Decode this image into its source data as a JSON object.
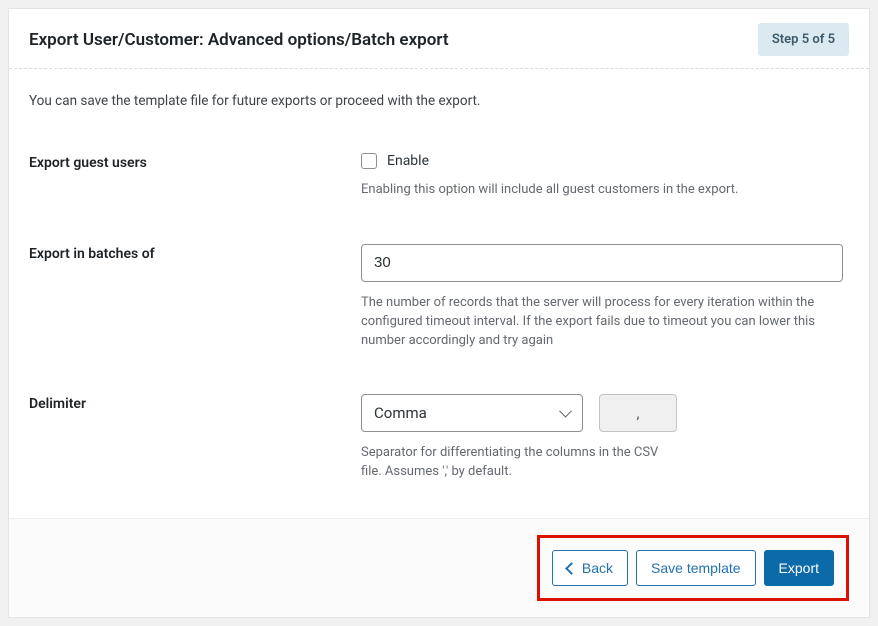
{
  "header": {
    "title": "Export User/Customer: Advanced options/Batch export",
    "step_badge": "Step 5 of 5"
  },
  "intro": "You can save the template file for future exports or proceed with the export.",
  "fields": {
    "guest_users": {
      "label": "Export guest users",
      "checkbox_label": "Enable",
      "help": "Enabling this option will include all guest customers in the export."
    },
    "batch": {
      "label": "Export in batches of",
      "value": "30",
      "help": "The number of records that the server will process for every iteration within the configured timeout interval. If the export fails due to timeout you can lower this number accordingly and try again"
    },
    "delimiter": {
      "label": "Delimiter",
      "selected": "Comma",
      "preview": ",",
      "help": "Separator for differentiating the columns in the CSV file. Assumes ',' by default."
    }
  },
  "footer": {
    "back": "Back",
    "save_template": "Save template",
    "export": "Export"
  }
}
